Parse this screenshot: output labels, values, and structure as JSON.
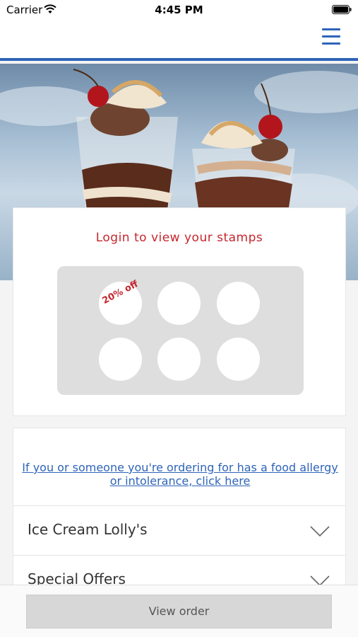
{
  "status_bar": {
    "carrier": "Carrier",
    "time": "4:45 PM"
  },
  "nav": {
    "menu_icon": "hamburger-menu-icon",
    "accent_color": "#2f64b9"
  },
  "hero": {
    "image": "ice-cream-sundae-photo"
  },
  "loyalty": {
    "login_prompt": "Login to view your stamps",
    "reward_label": "20% off",
    "reward_color": "#c6262e"
  },
  "allergy": {
    "link_text": "If you or someone you're ordering for has a food allergy or intolerance, click here"
  },
  "categories": [
    {
      "label": "Ice Cream Lolly's"
    },
    {
      "label": "Special Offers"
    }
  ],
  "footer": {
    "view_order_label": "View order"
  }
}
